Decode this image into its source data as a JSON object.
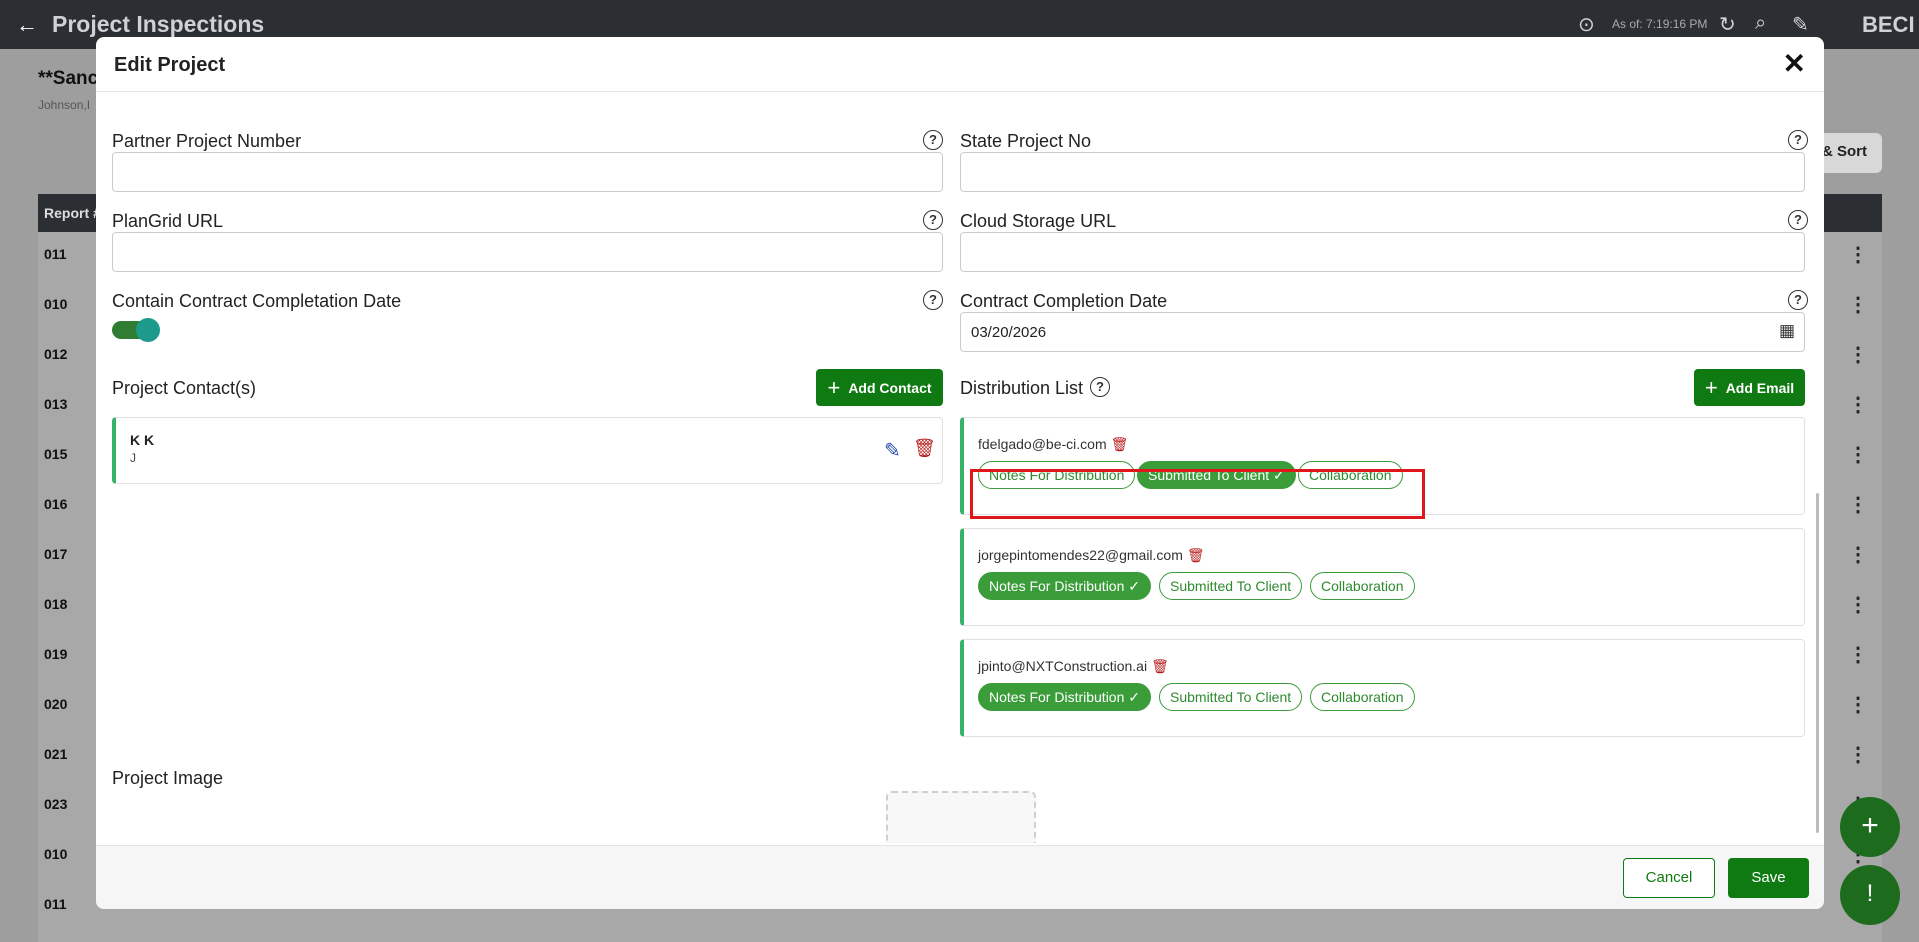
{
  "topbar": {
    "title": "Project Inspections",
    "as_of": "As of: 7:19:16 PM",
    "brand": "BECI"
  },
  "background": {
    "title": "**Sanc",
    "subtitle": "Johnson,I",
    "sort_label": "& Sort",
    "table_header": "Report #",
    "rows": [
      "011",
      "010",
      "012",
      "013",
      "015",
      "016",
      "017",
      "018",
      "019",
      "020",
      "021",
      "023",
      "010",
      "011"
    ]
  },
  "modal": {
    "title": "Edit Project",
    "fields": {
      "partner_project_number": {
        "label": "Partner Project Number",
        "value": ""
      },
      "state_project_no": {
        "label": "State Project No",
        "value": ""
      },
      "plangrid_url": {
        "label": "PlanGrid URL",
        "value": ""
      },
      "cloud_storage_url": {
        "label": "Cloud Storage URL",
        "value": ""
      },
      "contain_completion": {
        "label": "Contain Contract Completation Date",
        "enabled": true
      },
      "contract_completion_date": {
        "label": "Contract Completion Date",
        "value": "03/20/2026"
      }
    },
    "contacts": {
      "label": "Project Contact(s)",
      "add_label": "Add Contact",
      "items": [
        {
          "name": "K K",
          "sub": "J"
        }
      ]
    },
    "distribution": {
      "label": "Distribution List",
      "add_label": "Add Email",
      "items": [
        {
          "email": "fdelgado@be-ci.com",
          "chips": [
            {
              "label": "Notes For Distribution",
              "active": false
            },
            {
              "label": "Submitted To Client ✓",
              "active": true
            },
            {
              "label": "Collaboration",
              "active": false
            }
          ]
        },
        {
          "email": "jorgepintomendes22@gmail.com",
          "chips": [
            {
              "label": "Notes For Distribution ✓",
              "active": true
            },
            {
              "label": "Submitted To Client",
              "active": false
            },
            {
              "label": "Collaboration",
              "active": false
            }
          ]
        },
        {
          "email": "jpinto@NXTConstruction.ai",
          "chips": [
            {
              "label": "Notes For Distribution ✓",
              "active": true
            },
            {
              "label": "Submitted To Client",
              "active": false
            },
            {
              "label": "Collaboration",
              "active": false
            }
          ]
        }
      ]
    },
    "project_image_label": "Project Image",
    "cancel_label": "Cancel",
    "save_label": "Save"
  },
  "colors": {
    "accent": "#0f7a12",
    "chip_active": "#3a9d3a",
    "highlight": "#e0161b",
    "topbar": "#2b2e33"
  }
}
